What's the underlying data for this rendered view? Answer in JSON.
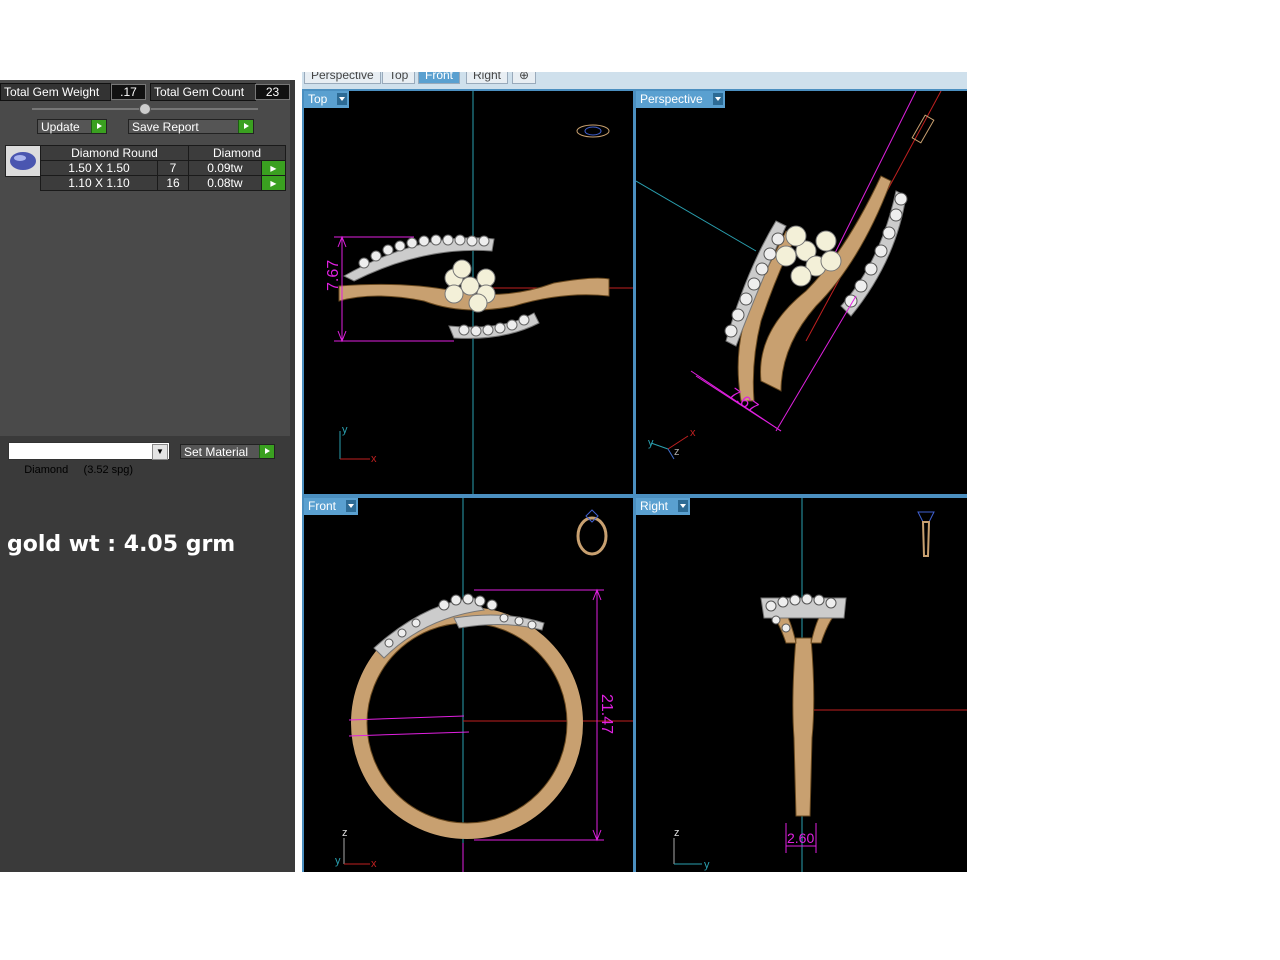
{
  "left_panel": {
    "total_gem_weight_label": "Total Gem Weight",
    "total_gem_weight_value": ".17",
    "total_gem_count_label": "Total Gem Count",
    "total_gem_count_value": "23",
    "update_label": "Update",
    "save_report_label": "Save Report",
    "gem_table": {
      "headers": [
        "Diamond Round",
        "Diamond"
      ],
      "rows": [
        {
          "size": "1.50 X 1.50",
          "count": "7",
          "weight": "0.09tw"
        },
        {
          "size": "1.10 X 1.10",
          "count": "16",
          "weight": "0.08tw"
        }
      ]
    },
    "material_select_value": "Diamond     (3.52 spg)",
    "set_material_label": "Set Material",
    "gold_weight_text": "gold wt : 4.05 grm"
  },
  "tabs": [
    "Perspective",
    "Top",
    "Front",
    "Right",
    "⊕"
  ],
  "viewports": {
    "top": {
      "label": "Top",
      "dimension": "7.67",
      "axis_v": "y",
      "axis_h": "x"
    },
    "perspective": {
      "label": "Perspective",
      "dimension": "7.67",
      "axis_1": "y",
      "axis_2": "z",
      "axis_3": "x"
    },
    "front": {
      "label": "Front",
      "dimension": "21.47",
      "axis_v": "z",
      "axis_h": "x",
      "axis_d": "y"
    },
    "right": {
      "label": "Right",
      "dimension": "2.60",
      "axis_v": "z",
      "axis_h": "y"
    }
  },
  "colors": {
    "panel_bg": "#3a3a3a",
    "accent_blue": "#5aa0d0",
    "green_button": "#3aa020",
    "dimension_magenta": "#e020e0",
    "gold": "#c8a070",
    "axis_cyan": "#2aa0b0",
    "axis_red": "#c02020"
  }
}
